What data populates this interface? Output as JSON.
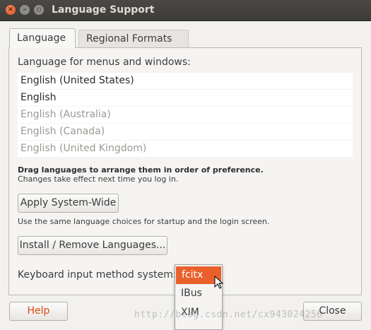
{
  "window": {
    "title": "Language Support"
  },
  "tabs": [
    {
      "label": "Language",
      "active": true
    },
    {
      "label": "Regional Formats",
      "active": false
    }
  ],
  "language_panel": {
    "menus_label": "Language for menus and windows:",
    "languages": [
      {
        "label": "English (United States)",
        "state": "primary"
      },
      {
        "label": "English",
        "state": "primary"
      },
      {
        "label": "English (Australia)",
        "state": "inactive"
      },
      {
        "label": "English (Canada)",
        "state": "inactive"
      },
      {
        "label": "English (United Kingdom)",
        "state": "inactive"
      }
    ],
    "drag_hint": "Drag languages to arrange them in order of preference.",
    "change_hint": "Changes take effect next time you log in.",
    "apply_button": "Apply System-Wide",
    "apply_hint": "Use the same language choices for startup and the login screen.",
    "install_button": "Install / Remove Languages...",
    "keyboard_label": "Keyboard input method system:",
    "keyboard_options": [
      "fcitx",
      "IBus",
      "XIM"
    ],
    "keyboard_selected": "fcitx"
  },
  "footer": {
    "help_button": "Help",
    "close_button": "Close"
  },
  "watermark": "http://blog.csdn.net/cx943024256",
  "colors": {
    "accent": "#e9602c",
    "titlebar": "#3c3b37",
    "help_text": "#dd4814"
  }
}
